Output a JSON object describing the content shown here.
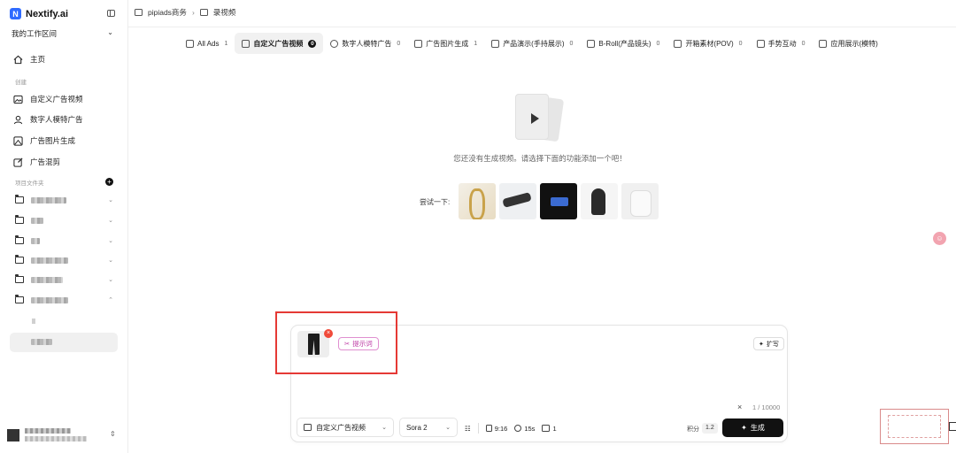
{
  "brand": {
    "name": "Nextify.ai",
    "logo_letter": "N"
  },
  "sidebar": {
    "workspace": "我的工作区间",
    "home": "主页",
    "create_section": "创建",
    "create_items": [
      "自定义广告视频",
      "数字人模特广告",
      "广告图片生成",
      "广告混剪"
    ],
    "folders_section": "项目文件夹",
    "folder_count": 6
  },
  "breadcrumb": {
    "root": "pipiads商务",
    "current": "录视频"
  },
  "tabs": [
    {
      "label": "All Ads",
      "count": "1"
    },
    {
      "label": "自定义广告视频",
      "count": "0"
    },
    {
      "label": "数字人模特广告",
      "count": "0"
    },
    {
      "label": "广告图片生成",
      "count": "1"
    },
    {
      "label": "产品演示(手持展示)",
      "count": "0"
    },
    {
      "label": "B-Roll(产品镜头)",
      "count": "0"
    },
    {
      "label": "开箱素材(POV)",
      "count": "0"
    },
    {
      "label": "手势互动",
      "count": "0"
    },
    {
      "label": "应用展示(模特)",
      "count": ""
    }
  ],
  "empty_state": {
    "message": "您还没有生成视频。请选择下面的功能添加一个吧！",
    "try_label": "尝试一下:"
  },
  "composer": {
    "prompt_chip": "提示词",
    "expand": "扩写",
    "counter": "1 / 10000",
    "mode": "自定义广告视频",
    "model": "Sora 2",
    "aspect": "9:16",
    "duration": "15s",
    "quantity": "1",
    "credits_label": "积分",
    "credits_value": "1.2",
    "generate": "生成"
  }
}
